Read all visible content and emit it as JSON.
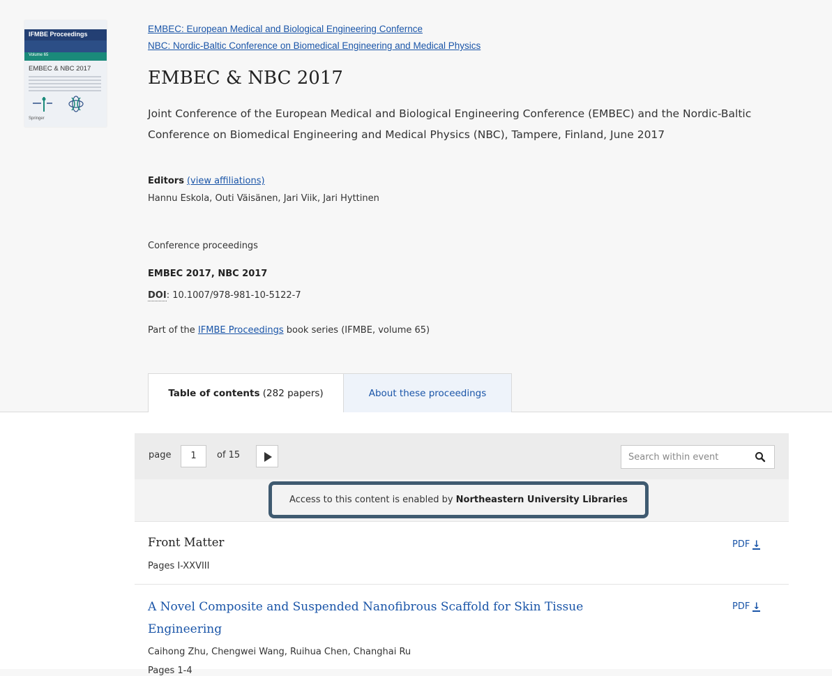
{
  "cover": {
    "series": "IFMBE Proceedings",
    "editors_line": "Hannu Eskola · Outi Väisänen · Jari Viik · Jari Hyttinen (Eds.)",
    "volume": "Volume 65",
    "title": "EMBEC & NBC 2017",
    "publisher": "Springer"
  },
  "header": {
    "series_link_1": "EMBEC: European Medical and Biological Engineering Confernce",
    "series_link_2": "NBC: Nordic-Baltic Conference on Biomedical Engineering and Medical Physics",
    "title": "EMBEC & NBC 2017",
    "subtitle": "Joint Conference of the European Medical and Biological Engineering Conference (EMBEC) and the Nordic-Baltic Conference on Biomedical Engineering and Medical Physics (NBC), Tampere, Finland, June 2017"
  },
  "editors": {
    "label": "Editors",
    "affiliations_link": "(view affiliations)",
    "names": "Hannu Eskola, Outi Väisänen, Jari Viik, Jari Hyttinen"
  },
  "meta": {
    "type": "Conference proceedings",
    "acronyms": "EMBEC 2017, NBC 2017",
    "doi_label": "DOI",
    "doi_value": ": 10.1007/978-981-10-5122-7",
    "part_of_prefix": "Part of the ",
    "part_of_link": "IFMBE Proceedings",
    "part_of_suffix": " book series (IFMBE, volume 65)"
  },
  "tabs": {
    "toc_label": "Table of contents",
    "toc_count": "(282 papers)",
    "about_label": "About these proceedings"
  },
  "pager": {
    "page_label": "page",
    "current_page": "1",
    "of_label": "of 15",
    "search_placeholder": "Search within event"
  },
  "access": {
    "prefix": "Access to this content is enabled by ",
    "institution": "Northeastern University Libraries"
  },
  "entries": [
    {
      "title": "Front Matter",
      "pages": "Pages I-XXVIII",
      "pdf_label": "PDF"
    },
    {
      "title": "A Novel Composite and Suspended Nanofibrous Scaffold for Skin Tissue Engineering",
      "authors": "Caihong Zhu, Chengwei Wang, Ruihua Chen, Changhai Ru",
      "pages": "Pages 1-4",
      "pdf_label": "PDF"
    }
  ],
  "colors": {
    "link": "#1a55a8",
    "highlight_border": "#3f5a70",
    "cover_band": "#233f73"
  }
}
